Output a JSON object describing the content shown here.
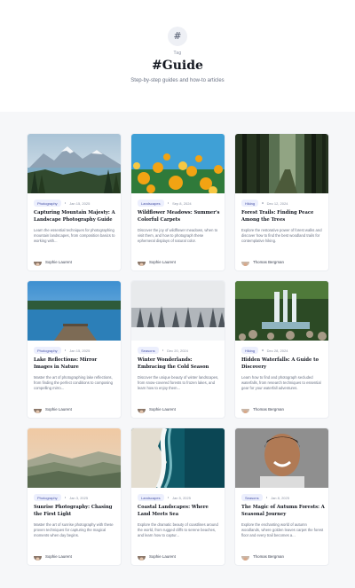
{
  "header": {
    "icon": "hash-icon",
    "badge_symbol": "#",
    "eyebrow": "Tag",
    "title": "#Guide",
    "subtitle": "Step-by-step guides and how-to articles"
  },
  "articles": [
    {
      "image": "mountain-lake",
      "tag": "Photography",
      "date": "Jan 15, 2025",
      "title": "Capturing Mountain Majesty: A Landscape Photography Guide",
      "excerpt": "Learn the essential techniques for photographing mountain landscapes, from composition basics to working with...",
      "author": "Sophie Laurent"
    },
    {
      "image": "wildflowers",
      "tag": "Landscapes",
      "date": "Sep 8, 2024",
      "title": "Wildflower Meadows: Summer's Colorful Carpets",
      "excerpt": "Discover the joy of wildflower meadows, when to visit them, and how to photograph these ephemeral displays of natural color.",
      "author": "Sophie Laurent"
    },
    {
      "image": "forest-trail",
      "tag": "Hiking",
      "date": "Dec 12, 2024",
      "title": "Forest Trails: Finding Peace Among the Trees",
      "excerpt": "Explore the restorative power of forest walks and discover how to find the best woodland trails for contemplative hiking.",
      "author": "Thomas Bergman"
    },
    {
      "image": "lake-dock",
      "tag": "Photography",
      "date": "Jan 15, 2025",
      "title": "Lake Reflections: Mirror Images in Nature",
      "excerpt": "Master the art of photographing lake reflections, from finding the perfect conditions to composing compelling mirro...",
      "author": "Sophie Laurent"
    },
    {
      "image": "winter-forest",
      "tag": "Seasons",
      "date": "Dec 20, 2024",
      "title": "Winter Wonderlands: Embracing the Cold Season",
      "excerpt": "Discover the unique beauty of winter landscapes, from snow-covered forests to frozen lakes, and learn how to enjoy them...",
      "author": "Sophie Laurent"
    },
    {
      "image": "waterfall",
      "tag": "Hiking",
      "date": "Dec 28, 2024",
      "title": "Hidden Waterfalls: A Guide to Discovery",
      "excerpt": "Learn how to find and photograph secluded waterfalls, from research techniques to essential gear for your waterfall adventures.",
      "author": "Thomas Bergman"
    },
    {
      "image": "sunrise-hills",
      "tag": "Photography",
      "date": "Jan 3, 2025",
      "title": "Sunrise Photography: Chasing the First Light",
      "excerpt": "Master the art of sunrise photography with these proven techniques for capturing the magical moments when day begins.",
      "author": "Sophie Laurent"
    },
    {
      "image": "coastal-aerial",
      "tag": "Landscapes",
      "date": "Jan 5, 2025",
      "title": "Coastal Landscapes: Where Land Meets Sea",
      "excerpt": "Explore the dramatic beauty of coastlines around the world, from rugged cliffs to serene beaches, and learn how to captur...",
      "author": "Sophie Laurent"
    },
    {
      "image": "portrait",
      "tag": "Seasons",
      "date": "Jan 8, 2025",
      "title": "The Magic of Autumn Forests: A Seasonal Journey",
      "excerpt": "Explore the enchanting world of autumn woodlands, where golden leaves carpet the forest floor and every trail becomes a...",
      "author": "Thomas Bergman"
    }
  ]
}
